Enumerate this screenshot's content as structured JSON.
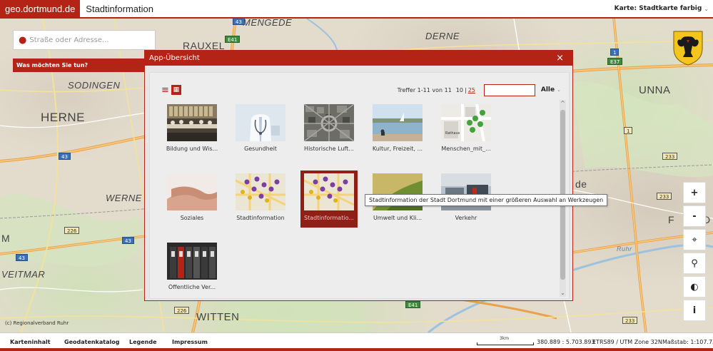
{
  "header": {
    "brand": "geo.dortmund.de",
    "title": "Stadtinformation",
    "map_label": "Karte: Stadtkarte farbig",
    "map_chevron": "⌄"
  },
  "search": {
    "placeholder": "Straße oder Adresse...",
    "value": ""
  },
  "left_panel": {
    "label": "Was möchten Sie tun?"
  },
  "map": {
    "places": [
      "MENGEDE",
      "RAUXEL",
      "DERNE",
      "SODINGEN",
      "HERNE",
      "UNNA",
      "WERNE",
      "WITTEN",
      "VEITMAR",
      "Ruhr",
      "de",
      "F",
      "D",
      "M"
    ],
    "shields": [
      "E41",
      "E41",
      "43",
      "43",
      "226",
      "43",
      "43",
      "226",
      "233",
      "233",
      "233",
      "1",
      "E37",
      "1"
    ]
  },
  "modal": {
    "title": "App-Übersicht",
    "close": "×",
    "hits": "Treffer 1-11 von 11",
    "page_sizes": [
      "10",
      "25"
    ],
    "filter_value": "",
    "scope": "Alle",
    "scroll_up": "^",
    "scroll_down": "⌄",
    "apps": [
      {
        "label": "Bildung und Wis..."
      },
      {
        "label": "Gesundheit"
      },
      {
        "label": "Historische Luft..."
      },
      {
        "label": "Kultur, Freizeit, ..."
      },
      {
        "label": "Menschen_mit_..."
      },
      {
        "label": "Soziales"
      },
      {
        "label": "Stadtinformation"
      },
      {
        "label": "Stadtinformatio..."
      },
      {
        "label": "Umwelt und Kli..."
      },
      {
        "label": "Verkehr"
      },
      {
        "label": "Öffentliche Ver..."
      }
    ],
    "tooltip": "Stadtinformation der Stadt Dortmund mit einer größeren Auswahl an Werkzeugen",
    "thumb_texts": {
      "map_label": "Rathaus"
    }
  },
  "tools": {
    "zoom_in": "+",
    "zoom_out": "-",
    "locate": "⌖",
    "search_zoom": "⚲",
    "globe": "◐",
    "info": "i"
  },
  "copyright": "(c) Regionalverband Ruhr",
  "footer": {
    "links": [
      "Karteninhalt",
      "Geodatenkatalog",
      "Legende",
      "Impressum"
    ],
    "scale_label": "3km",
    "coords": "380.889 : 5.703.893",
    "crs": "ETRS89 / UTM Zone 32N",
    "scale": "Maßstab: 1:107.731"
  },
  "colors": {
    "accent": "#b32417"
  }
}
